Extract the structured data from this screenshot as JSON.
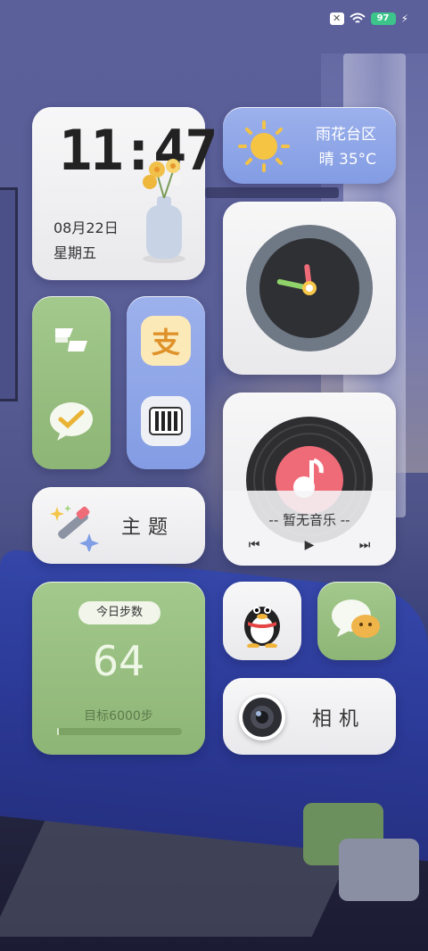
{
  "status_bar": {
    "sim_icon": "no-sim-icon",
    "wifi_icon": "wifi-icon",
    "battery_level": "97",
    "charging_icon": "charging-bolt-icon"
  },
  "clock_widget": {
    "time": "11:47",
    "date": "08月22日",
    "weekday": "星期五"
  },
  "weather_widget": {
    "location": "雨花台区",
    "condition_temp": "晴 35°C",
    "icon": "sun-icon"
  },
  "analog_clock": {
    "hour": 11,
    "minute": 47
  },
  "app_stacks": {
    "green": [
      "feishu-lark-icon",
      "wechat-check-icon"
    ],
    "blue": [
      "alipay-icon",
      "piano-keys-icon"
    ]
  },
  "music_widget": {
    "status": "-- 暂无音乐 --",
    "prev_icon": "previous-track-icon",
    "play_icon": "play-icon",
    "next_icon": "next-track-icon"
  },
  "theme_widget": {
    "label": "主题",
    "icon": "magic-wand-icon"
  },
  "steps_widget": {
    "title": "今日步数",
    "count": "64",
    "goal": "目标6000步",
    "progress_fraction": 0.011
  },
  "qq_widget": {
    "icon": "qq-penguin-icon"
  },
  "wechat_widget": {
    "icon": "wechat-icon"
  },
  "camera_widget": {
    "label": "相机",
    "icon": "camera-lens-icon"
  },
  "colors": {
    "widget_light": "#f0f0f2",
    "widget_green": "#98c07f",
    "widget_blue": "#8fa7e8",
    "minute_hand": "#8fd36a",
    "hour_hand": "#ef6b78"
  }
}
